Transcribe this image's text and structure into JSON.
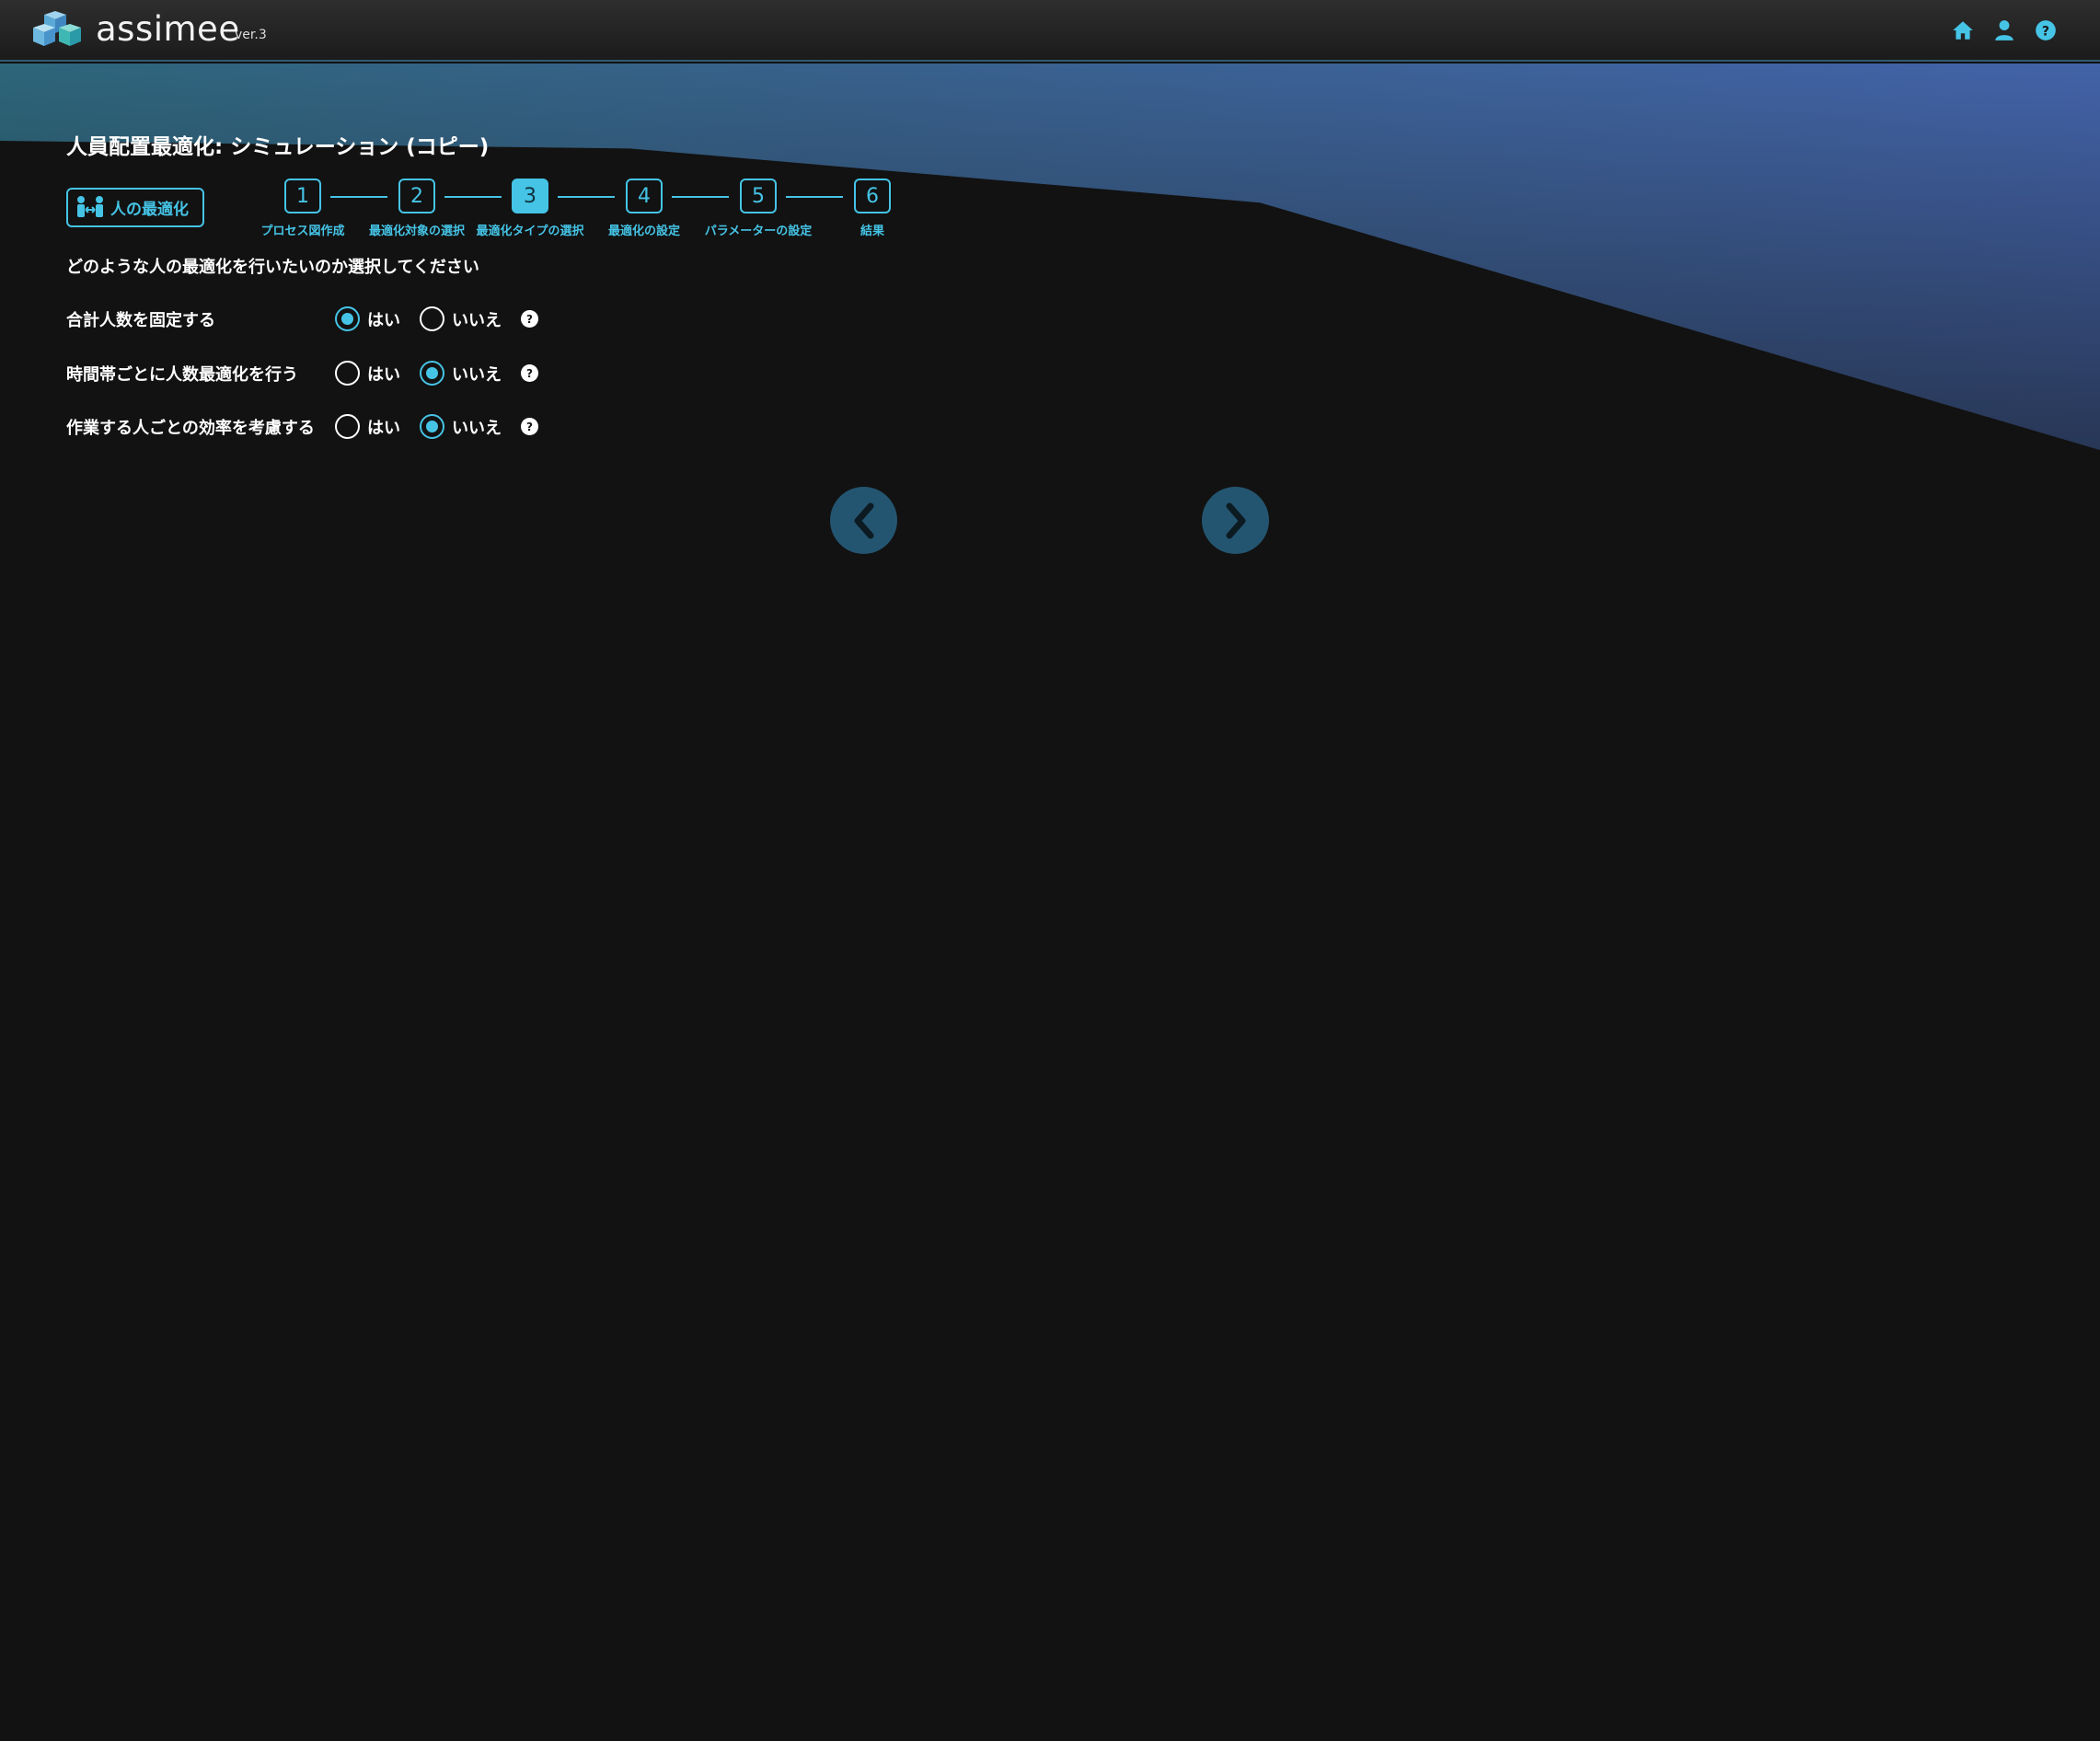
{
  "header": {
    "logo_text": "assimee",
    "version": "ver.3",
    "icons": [
      "home-icon",
      "user-icon",
      "help-icon"
    ]
  },
  "page": {
    "title": "人員配置最適化: シミュレーション (コピー)",
    "type_badge": "人の最適化",
    "prompt": "どのような人の最適化を行いたいのか選択してください"
  },
  "stepper": {
    "current": 3,
    "steps": [
      {
        "num": "1",
        "label": "プロセス図作成"
      },
      {
        "num": "2",
        "label": "最適化対象の選択"
      },
      {
        "num": "3",
        "label": "最適化タイプの選択"
      },
      {
        "num": "4",
        "label": "最適化の設定"
      },
      {
        "num": "5",
        "label": "パラメーターの設定"
      },
      {
        "num": "6",
        "label": "結果"
      }
    ]
  },
  "options": [
    {
      "label": "合計人数を固定する",
      "yes": "はい",
      "no": "いいえ",
      "selected": "yes",
      "help": "?"
    },
    {
      "label": "時間帯ごとに人数最適化を行う",
      "yes": "はい",
      "no": "いいえ",
      "selected": "no",
      "help": "?"
    },
    {
      "label": "作業する人ごとの効率を考慮する",
      "yes": "はい",
      "no": "いいえ",
      "selected": "no",
      "help": "?"
    }
  ],
  "colors": {
    "accent": "#45c4e6",
    "nav_button": "#245570",
    "background": "#121212"
  }
}
